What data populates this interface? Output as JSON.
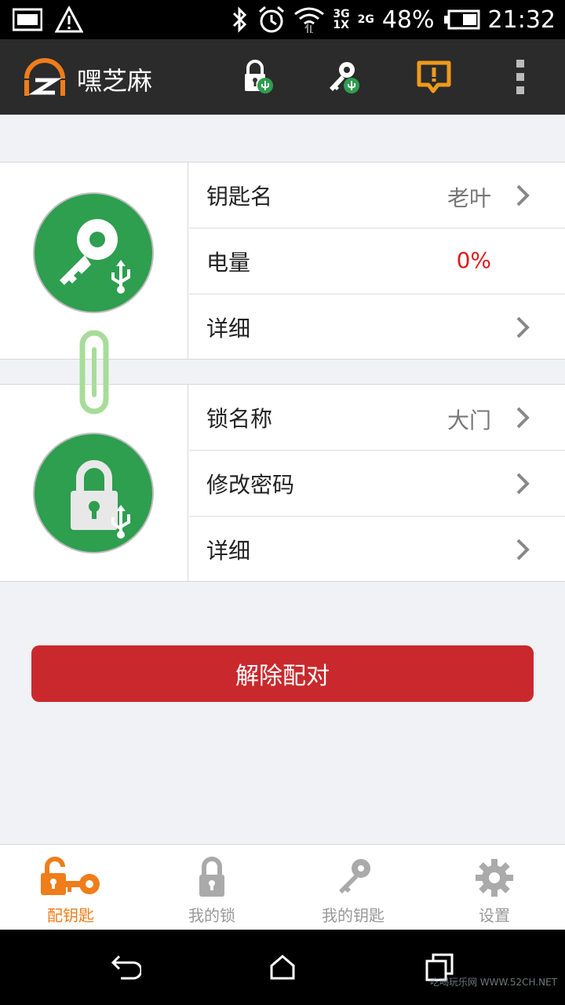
{
  "status_bar": {
    "network_top": "3G",
    "network_bottom": "1X",
    "network2": "2G",
    "battery": "48%",
    "time": "21:32"
  },
  "app_bar": {
    "title": "嘿芝麻"
  },
  "key_panel": {
    "rows": [
      {
        "label": "钥匙名",
        "value": "老叶"
      },
      {
        "label": "电量",
        "value": "0%"
      },
      {
        "label": "详细",
        "value": ""
      }
    ]
  },
  "lock_panel": {
    "rows": [
      {
        "label": "锁名称",
        "value": "大门"
      },
      {
        "label": "修改密码",
        "value": ""
      },
      {
        "label": "详细",
        "value": ""
      }
    ]
  },
  "unpair_label": "解除配对",
  "bottom_nav": [
    {
      "label": "配钥匙",
      "icon": "unlock-key-icon",
      "active": true
    },
    {
      "label": "我的锁",
      "icon": "lock-icon",
      "active": false
    },
    {
      "label": "我的钥匙",
      "icon": "key-icon",
      "active": false
    },
    {
      "label": "设置",
      "icon": "gear-icon",
      "active": false
    }
  ],
  "watermark": "吃喝玩乐网 WWW.52CH.NET",
  "colors": {
    "accent": "#ef7d1a",
    "green": "#2e9e4f",
    "danger": "#c9292d",
    "battery_red": "#e01b1b"
  }
}
